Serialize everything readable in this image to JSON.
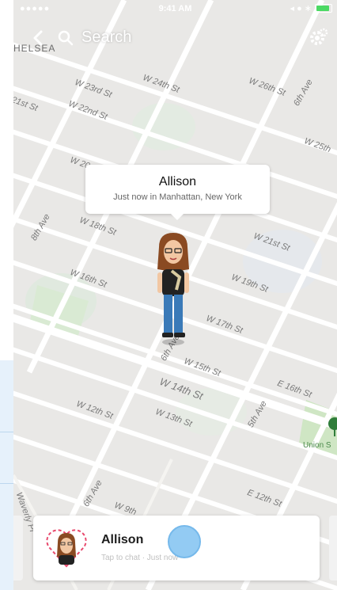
{
  "status_bar": {
    "signal": "●●●●● ",
    "time": "9:41 AM",
    "right": "◂ ● ∗"
  },
  "top_bar": {
    "search_label": "Search",
    "neighborhood": "HELSEA"
  },
  "streets": [
    "W 24th St",
    "W 23rd St",
    "W 22nd St",
    "21st St",
    "W 26th St",
    "6th Ave",
    "W 25th",
    "W 20",
    "8th Ave",
    "W 18th St",
    "W 16th St",
    "W 21st St",
    "W 19th St",
    "W 17th St",
    "W 15th St",
    "6th Ave",
    "W 14th St",
    "E 16th St",
    "W 12th St",
    "W 13th St",
    "5th Ave",
    "Waverly Pl",
    "6th Ave",
    "W 9th",
    "E 12th St"
  ],
  "callout": {
    "name": "Allison",
    "subtitle": "Just now in Manhattan, New York"
  },
  "union_square": {
    "label": "Union S"
  },
  "friend_card": {
    "name": "Allison",
    "subtitle": "Tap to chat · Just now"
  },
  "colors": {
    "map_bg": "#e9e8e6",
    "road": "#ffffff",
    "park": "#cfe6c4",
    "tap_dot": "#8ec9f3"
  },
  "icons": [
    "back-icon",
    "search-icon",
    "settings-icon",
    "bitmoji-avatar",
    "park-pin-icon"
  ]
}
